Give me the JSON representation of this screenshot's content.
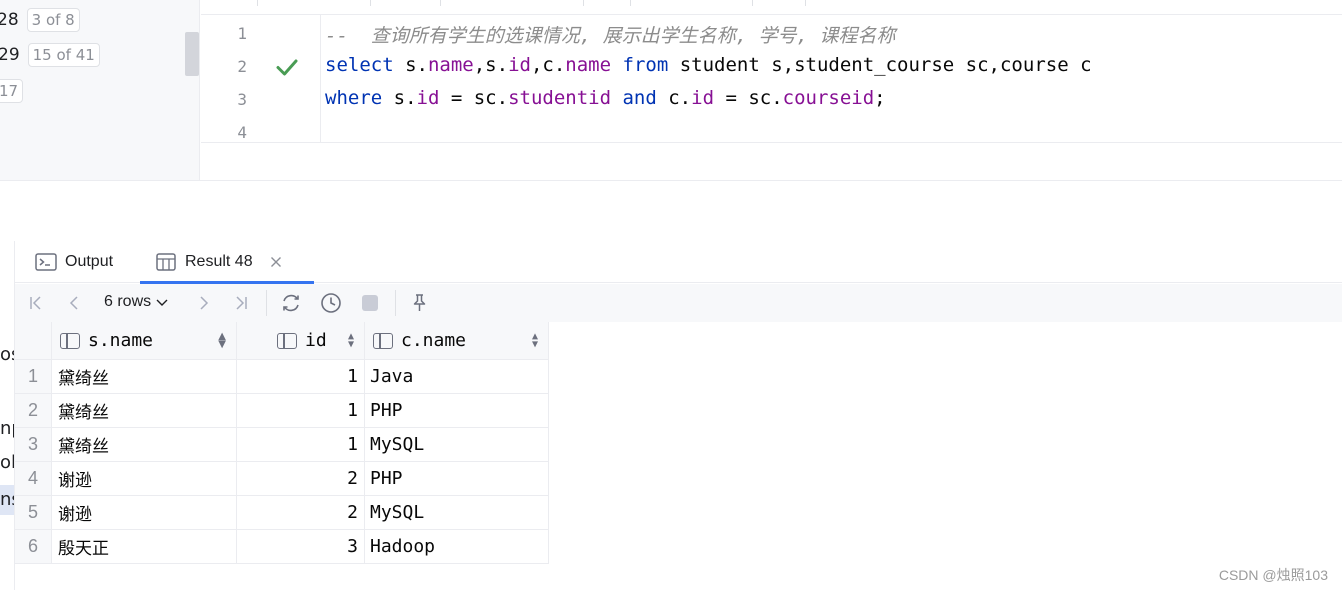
{
  "sidebar": {
    "items": [
      {
        "num": "28",
        "badge": "3 of 8"
      },
      {
        "num": "29",
        "badge": "15 of 41"
      },
      {
        "num": "",
        "badge": "17"
      }
    ],
    "clipped_labels": [
      "os",
      "np",
      "ole",
      "ns"
    ]
  },
  "editor": {
    "line_numbers": [
      "1",
      "2",
      "3",
      "4"
    ],
    "lines": [
      [
        {
          "t": "--  查询所有学生的选课情况, 展示出学生名称, 学号, 课程名称",
          "c": "cmt"
        }
      ],
      [
        {
          "t": "select",
          "c": "kw"
        },
        {
          "t": " s.",
          "c": ""
        },
        {
          "t": "name",
          "c": "fld"
        },
        {
          "t": ",s.",
          "c": ""
        },
        {
          "t": "id",
          "c": "fld"
        },
        {
          "t": ",c.",
          "c": ""
        },
        {
          "t": "name",
          "c": "fld"
        },
        {
          "t": " ",
          "c": ""
        },
        {
          "t": "from",
          "c": "kw"
        },
        {
          "t": " student s,student_course sc,course c",
          "c": ""
        }
      ],
      [
        {
          "t": "where",
          "c": "kw"
        },
        {
          "t": " s.",
          "c": ""
        },
        {
          "t": "id",
          "c": "fld"
        },
        {
          "t": " = sc.",
          "c": ""
        },
        {
          "t": "studentid",
          "c": "fld"
        },
        {
          "t": " ",
          "c": ""
        },
        {
          "t": "and",
          "c": "kw"
        },
        {
          "t": " c.",
          "c": ""
        },
        {
          "t": "id",
          "c": "fld"
        },
        {
          "t": " = sc.",
          "c": ""
        },
        {
          "t": "courseid",
          "c": "fld"
        },
        {
          "t": ";",
          "c": ""
        }
      ],
      []
    ],
    "status_icon": "checkmark-icon"
  },
  "results": {
    "tabs": [
      {
        "label": "Output",
        "icon": "console-icon",
        "active": false
      },
      {
        "label": "Result 48",
        "icon": "table-icon",
        "active": true,
        "closable": true
      }
    ],
    "toolbar": {
      "rows_label": "6 rows",
      "icons": [
        "first-page-icon",
        "prev-page-icon",
        "next-page-icon",
        "last-page-icon",
        "refresh-icon",
        "history-icon",
        "stop-icon",
        "pin-icon"
      ]
    },
    "columns": [
      "s.name",
      "id",
      "c.name"
    ],
    "rows": [
      {
        "idx": "1",
        "name": "黛绮丝",
        "id": "1",
        "cname": "Java"
      },
      {
        "idx": "2",
        "name": "黛绮丝",
        "id": "1",
        "cname": "PHP"
      },
      {
        "idx": "3",
        "name": "黛绮丝",
        "id": "1",
        "cname": "MySQL"
      },
      {
        "idx": "4",
        "name": "谢逊",
        "id": "2",
        "cname": "PHP"
      },
      {
        "idx": "5",
        "name": "谢逊",
        "id": "2",
        "cname": "MySQL"
      },
      {
        "idx": "6",
        "name": "殷天正",
        "id": "3",
        "cname": "Hadoop"
      }
    ]
  },
  "watermark": "CSDN @烛照103",
  "colors": {
    "keyword": "#0033b3",
    "field": "#871094",
    "comment": "#8c8c8c",
    "check": "#499c54",
    "accent": "#3574f0"
  }
}
